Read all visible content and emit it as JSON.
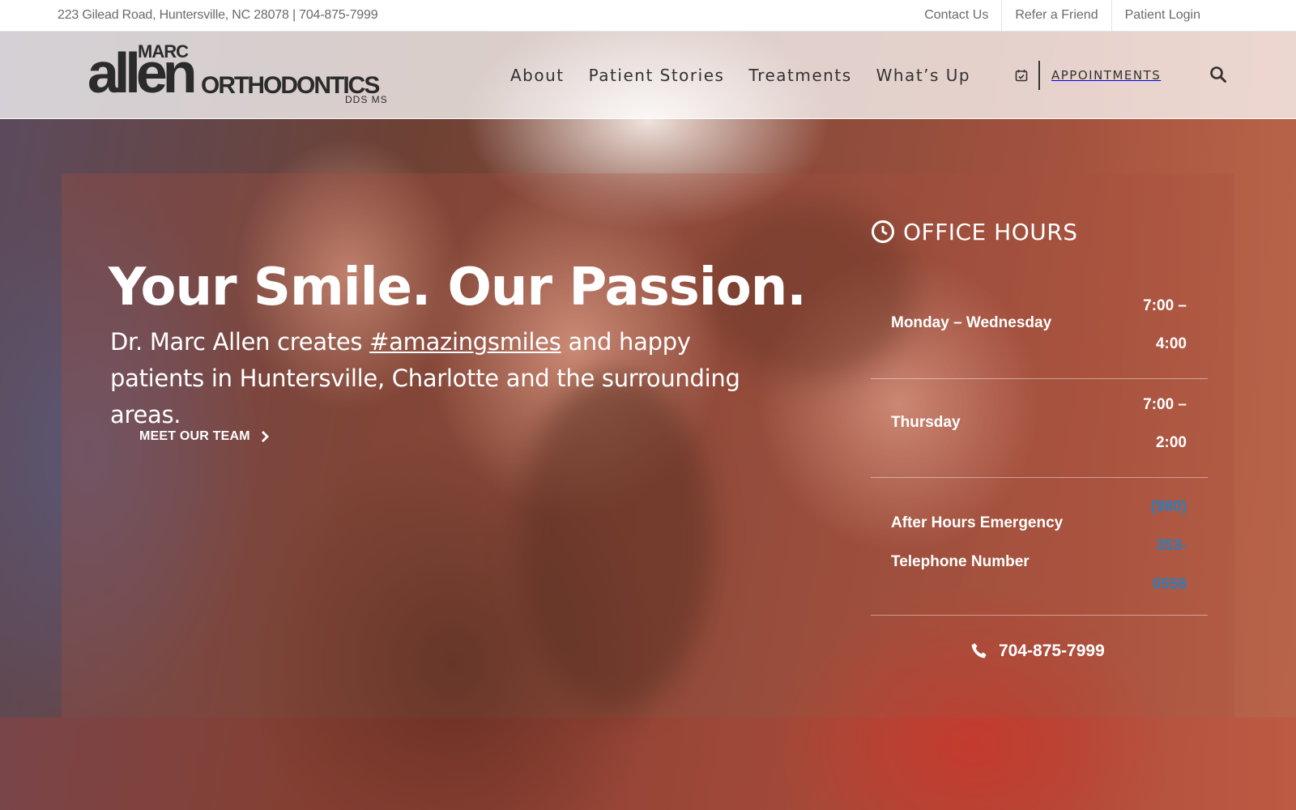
{
  "topbar": {
    "address": "223 Gilead Road, Huntersville, NC 28078 | 704-875-7999",
    "links": [
      "Contact Us",
      "Refer a Friend",
      "Patient Login"
    ]
  },
  "logo": {
    "marc": "MARC",
    "allen": "allen",
    "orthodontics": "ORTHODONTICS",
    "dds": "DDS MS"
  },
  "nav": {
    "items": [
      "About",
      "Patient Stories",
      "Treatments",
      "What’s Up"
    ],
    "appointments": "APPOINTMENTS"
  },
  "hero": {
    "headline": "Your Smile. Our Passion.",
    "sub_before": "Dr. Marc Allen creates ",
    "sub_hashtag": "#amazingsmiles",
    "sub_after": " and happy patients in Huntersville, Charlotte and the surrounding areas.",
    "cta": "MEET OUR TEAM"
  },
  "hours": {
    "title": "OFFICE HOURS",
    "rows": [
      {
        "day": "Monday – Wednesday",
        "time_1": "7:00 –",
        "time_2": "4:00"
      },
      {
        "day": "Thursday",
        "time_1": "7:00 –",
        "time_2": "2:00"
      }
    ],
    "emergency": {
      "label_1": "After Hours Emergency",
      "label_2": "Telephone Number",
      "phone_1": "(980)",
      "phone_2": "353-",
      "phone_3": "0558"
    },
    "phone": "704-875-7999"
  },
  "colors": {
    "link_blue": "#2a7fbd",
    "white": "#ffffff",
    "nav_text": "#333333"
  },
  "icons": {
    "calendar": "calendar-icon",
    "search": "search-icon",
    "clock": "clock-icon",
    "phone": "phone-icon",
    "chevron": "chevron-right-icon"
  }
}
